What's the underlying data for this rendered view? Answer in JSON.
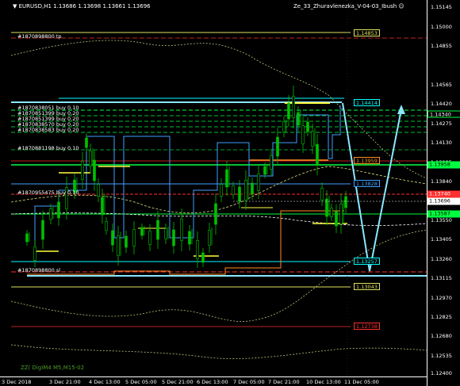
{
  "header": {
    "symbol_info": "▼ EURUSD,H1  1.13686 1.13698 1.13661 1.13696",
    "ea_name": "Ze_33_Zhuravlenezka_V-04-03_Ibush ☺"
  },
  "indicator_label": "ZZ( DigiM4 M5,M15-02",
  "price_axis": {
    "ticks": [
      "1.15145",
      "1.15000",
      "1.14855",
      "1.14565",
      "1.14420",
      "1.14275",
      "1.14130",
      "1.13985",
      "1.13840",
      "1.13696",
      "1.13550",
      "1.13405",
      "1.13260",
      "1.13115",
      "1.12970",
      "1.12825",
      "1.12680",
      "1.12535",
      "1.12400"
    ],
    "tags": [
      {
        "text": "1.14340",
        "color": "#ffffff",
        "bg": "#000000"
      },
      {
        "text": "1.13958",
        "color": "#ffffff",
        "bg": "#000000"
      },
      {
        "text": "1.13740",
        "color": "#ff3030",
        "bg": "#000000"
      },
      {
        "text": "1.13696",
        "color": "#ffffff",
        "bg": "#000000"
      },
      {
        "text": "1.13587",
        "color": "#ffffff",
        "bg": "#000000"
      }
    ]
  },
  "time_axis": {
    "ticks": [
      "3 Dec 2018",
      "3 Dec 21:00",
      "4 Dec 13:00",
      "5 Dec 05:00",
      "5 Dec 21:00",
      "6 Dec 13:00",
      "7 Dec 05:00",
      "7 Dec 21:00",
      "10 Dec 13:00",
      "11 Dec 05:00"
    ]
  },
  "order_labels": [
    {
      "text": "#1870898800 tp"
    },
    {
      "text": "#1870838051 buy 0.10"
    },
    {
      "text": "#1870851399 buy 0.20"
    },
    {
      "text": "#1870851399 buy 0.20"
    },
    {
      "text": "#1870838570 buy 0.20"
    },
    {
      "text": "#1870838583 buy 0.20"
    },
    {
      "text": "#1870881198 buy 0.10"
    },
    {
      "text": "#1870955475 buy 0.10"
    },
    {
      "text": "#1870898800 sl"
    }
  ],
  "level_boxes": [
    {
      "text": "1.14853",
      "color": "#e0e060"
    },
    {
      "text": "1.14414",
      "color": "#00ffff"
    },
    {
      "text": "1.13959",
      "color": "#ff9020"
    },
    {
      "text": "1.13828",
      "color": "#40a0ff"
    },
    {
      "text": "1.13257",
      "color": "#00ffff"
    },
    {
      "text": "1.13043",
      "color": "#e0e060"
    },
    {
      "text": "1.12738",
      "color": "#ff3030"
    }
  ],
  "colors": {
    "candle_up": "#00c000",
    "candle_down": "#00c000",
    "price_line": "#ffffff",
    "zigzag": "#40a0ff",
    "projection": "#8be8ff",
    "orange_channel": "#ff8c20",
    "yellow_level": "#ffff40",
    "green_level": "#00ff40",
    "red_level": "#ff3030"
  }
}
